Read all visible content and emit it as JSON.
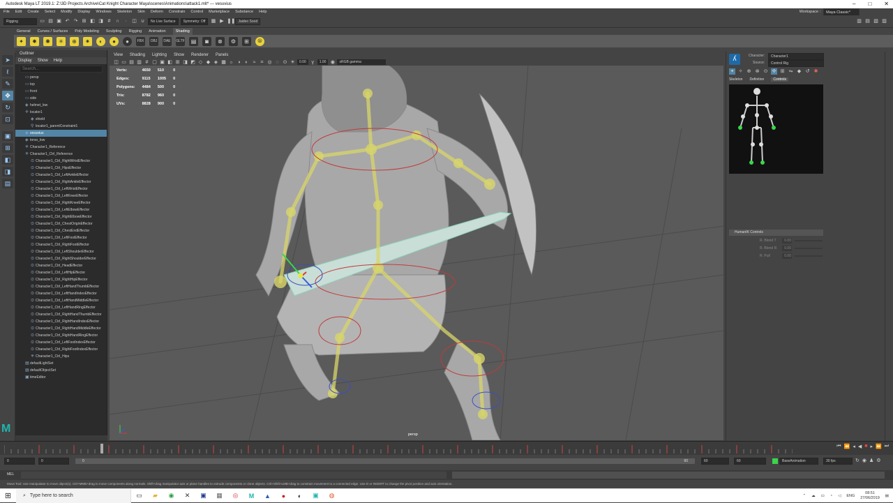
{
  "window": {
    "title": "Autodesk Maya LT 2019.1: Z:\\3D Projects Archive\\Cat Knight Character Maya\\scenes\\Animations\\attack1.mlt*  ---  vesuvius",
    "controls": [
      "–",
      "□",
      "✕"
    ]
  },
  "menubar": {
    "items": [
      "File",
      "Edit",
      "Create",
      "Select",
      "Modify",
      "Display",
      "Windows",
      "Skeleton",
      "Skin",
      "Deform",
      "Constrain",
      "Control",
      "Marketplace",
      "Substance",
      "Help"
    ],
    "workspace_label": "Workspace :",
    "workspace_value": "Maya Classic*"
  },
  "statusline": {
    "mode": "Rigging",
    "live_surface": "No Live Surface",
    "symmetry": "Symmetry: Off",
    "user": "Jaideo Sood"
  },
  "shelf": {
    "tabs": [
      "General",
      "Curves / Surfaces",
      "Poly Modeling",
      "Sculpting",
      "Rigging",
      "Animation",
      "Shading"
    ],
    "active_tab": "Shading"
  },
  "outliner": {
    "title": "Outliner",
    "menu": [
      "Display",
      "Show",
      "Help"
    ],
    "search_placeholder": "Search...",
    "items": [
      {
        "label": "persp",
        "icon": "camera",
        "indent": 1
      },
      {
        "label": "top",
        "icon": "camera",
        "indent": 1
      },
      {
        "label": "front",
        "icon": "camera",
        "indent": 1
      },
      {
        "label": "side",
        "icon": "camera",
        "indent": 1
      },
      {
        "label": "helmet_low",
        "icon": "mesh",
        "indent": 1
      },
      {
        "label": "locator1",
        "icon": "locator",
        "indent": 1
      },
      {
        "label": "shield",
        "icon": "mesh",
        "indent": 2
      },
      {
        "label": "locator1_parentConstraint1",
        "icon": "constraint",
        "indent": 2
      },
      {
        "label": "vesuvius",
        "icon": "mesh",
        "indent": 1,
        "selected": true
      },
      {
        "label": "torso_low",
        "icon": "mesh",
        "indent": 1
      },
      {
        "label": "Character1_Reference",
        "icon": "joint",
        "indent": 1
      },
      {
        "label": "Character1_Ctrl_Reference",
        "icon": "joint",
        "indent": 1
      },
      {
        "label": "Character1_Ctrl_RightWristEffector",
        "icon": "effector",
        "indent": 2
      },
      {
        "label": "Character1_Ctrl_HipsEffector",
        "icon": "effector",
        "indent": 2
      },
      {
        "label": "Character1_Ctrl_LeftAnkleEffector",
        "icon": "effector",
        "indent": 2
      },
      {
        "label": "Character1_Ctrl_RightAnkleEffector",
        "icon": "effector",
        "indent": 2
      },
      {
        "label": "Character1_Ctrl_LeftWristEffector",
        "icon": "effector",
        "indent": 2
      },
      {
        "label": "Character1_Ctrl_LeftKneeEffector",
        "icon": "effector",
        "indent": 2
      },
      {
        "label": "Character1_Ctrl_RightKneeEffector",
        "icon": "effector",
        "indent": 2
      },
      {
        "label": "Character1_Ctrl_LeftElbowEffector",
        "icon": "effector",
        "indent": 2
      },
      {
        "label": "Character1_Ctrl_RightElbowEffector",
        "icon": "effector",
        "indent": 2
      },
      {
        "label": "Character1_Ctrl_ChestOriginEffector",
        "icon": "effector",
        "indent": 2
      },
      {
        "label": "Character1_Ctrl_ChestEndEffector",
        "icon": "effector",
        "indent": 2
      },
      {
        "label": "Character1_Ctrl_LeftFootEffector",
        "icon": "effector",
        "indent": 2
      },
      {
        "label": "Character1_Ctrl_RightFootEffector",
        "icon": "effector",
        "indent": 2
      },
      {
        "label": "Character1_Ctrl_LeftShoulderEffector",
        "icon": "effector",
        "indent": 2
      },
      {
        "label": "Character1_Ctrl_RightShoulderEffector",
        "icon": "effector",
        "indent": 2
      },
      {
        "label": "Character1_Ctrl_HeadEffector",
        "icon": "effector",
        "indent": 2
      },
      {
        "label": "Character1_Ctrl_LeftHipEffector",
        "icon": "effector",
        "indent": 2
      },
      {
        "label": "Character1_Ctrl_RightHipEffector",
        "icon": "effector",
        "indent": 2
      },
      {
        "label": "Character1_Ctrl_LeftHandThumbEffector",
        "icon": "effector",
        "indent": 2
      },
      {
        "label": "Character1_Ctrl_LeftHandIndexEffector",
        "icon": "effector",
        "indent": 2
      },
      {
        "label": "Character1_Ctrl_LeftHandMiddleEffector",
        "icon": "effector",
        "indent": 2
      },
      {
        "label": "Character1_Ctrl_LeftHandRingEffector",
        "icon": "effector",
        "indent": 2
      },
      {
        "label": "Character1_Ctrl_RightHandThumbEffector",
        "icon": "effector",
        "indent": 2
      },
      {
        "label": "Character1_Ctrl_RightHandIndexEffector",
        "icon": "effector",
        "indent": 2
      },
      {
        "label": "Character1_Ctrl_RightHandMiddleEffector",
        "icon": "effector",
        "indent": 2
      },
      {
        "label": "Character1_Ctrl_RightHandRingEffector",
        "icon": "effector",
        "indent": 2
      },
      {
        "label": "Character1_Ctrl_LeftFootIndexEffector",
        "icon": "effector",
        "indent": 2
      },
      {
        "label": "Character1_Ctrl_RightFootIndexEffector",
        "icon": "effector",
        "indent": 2
      },
      {
        "label": "Character1_Ctrl_Hips",
        "icon": "joint",
        "indent": 2
      },
      {
        "label": "defaultLightSet",
        "icon": "set",
        "indent": 1
      },
      {
        "label": "defaultObjectSet",
        "icon": "set",
        "indent": 1
      },
      {
        "label": "timeEditor",
        "icon": "editor",
        "indent": 1
      }
    ]
  },
  "viewport": {
    "menu": [
      "View",
      "Shading",
      "Lighting",
      "Show",
      "Renderer",
      "Panels"
    ],
    "exposure": "0.00",
    "gamma": "1.00",
    "colorspace": "sRGB gamma",
    "hud": [
      {
        "label": "Verts:",
        "a": "4650",
        "b": "510",
        "c": "0"
      },
      {
        "label": "Edges:",
        "a": "9115",
        "b": "1005",
        "c": "0"
      },
      {
        "label": "Polygons:",
        "a": "4484",
        "b": "500",
        "c": "0"
      },
      {
        "label": "Tris:",
        "a": "8782",
        "b": "960",
        "c": "0"
      },
      {
        "label": "UVs:",
        "a": "8828",
        "b": "900",
        "c": "0"
      }
    ],
    "camera_label": "persp"
  },
  "character_panel": {
    "character_label": "Character:",
    "character_value": "Character1",
    "source_label": "Source:",
    "source_value": "Control Rig",
    "tabs": [
      "Skeleton",
      "Definition",
      "Controls"
    ],
    "active_tab": "Controls",
    "section_title": "HumanIK Controls",
    "fields": [
      {
        "label": "R. Blend T",
        "value": "0.00"
      },
      {
        "label": "R. Blend R",
        "value": "0.00"
      },
      {
        "label": "R. Pull",
        "value": "0.00"
      }
    ]
  },
  "timeline": {
    "current_frame": "0",
    "range_start": "0",
    "range_inner_start": "0",
    "range_inner_end": "60",
    "range_end": "60",
    "range_end2": "60",
    "anim_layer": "BaseAnimation",
    "fps": "30 fps"
  },
  "command_line": {
    "lang": "MEL"
  },
  "helpline": {
    "text": "Move Tool: Use manipulator to move object(s). Ctrl+MMB+drag to move components along normals. Shift+drag manipulator axis or plane handles to extrude components or clone objects. Ctrl+Shift+LMB+drag to constrain movement to a connected edge. Use D or INSERT to change the pivot position and axis orientation."
  },
  "taskbar": {
    "search_placeholder": "Type here to search",
    "lang": "ENG",
    "time": "08:51",
    "date": "27/06/2019"
  }
}
